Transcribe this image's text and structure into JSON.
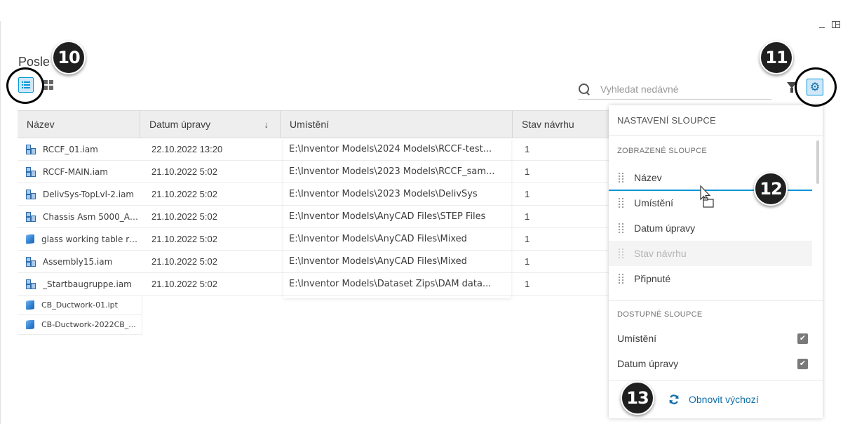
{
  "page": {
    "title": "Posle"
  },
  "search": {
    "placeholder": "Vyhledat nedávné"
  },
  "table": {
    "columns": [
      "Název",
      "Datum úpravy",
      "Umístění",
      "Stav návrhu"
    ],
    "rows": [
      {
        "icon": "assembly-icon",
        "name": "RCCF_01.iam",
        "date": "22.10.2022 13:20",
        "location": "E:\\Inventor Models\\2024 Models\\RCCF-test...",
        "state": "1"
      },
      {
        "icon": "assembly-icon",
        "name": "RCCF-MAIN.iam",
        "date": "21.10.2022 5:02",
        "location": "E:\\Inventor Models\\2023 Models\\RCCF_sam...",
        "state": "1"
      },
      {
        "icon": "assembly-icon",
        "name": "DelivSys-TopLvl-2.iam",
        "date": "21.10.2022 5:02",
        "location": "E:\\Inventor Models\\2023 Models\\DelivSys",
        "state": "1"
      },
      {
        "icon": "assembly-icon",
        "name": "Chassis Asm 5000_AP...",
        "date": "21.10.2022 5:02",
        "location": "E:\\Inventor Models\\AnyCAD Files\\STEP Files",
        "state": "1"
      },
      {
        "icon": "part-icon",
        "name": "glass working table rh...",
        "date": "21.10.2022 5:02",
        "location": "E:\\Inventor Models\\AnyCAD Files\\Mixed",
        "state": "1"
      },
      {
        "icon": "assembly-icon",
        "name": "Assembly15.iam",
        "date": "21.10.2022 5:02",
        "location": "E:\\Inventor Models\\AnyCAD Files\\Mixed",
        "state": "1"
      },
      {
        "icon": "assembly-icon",
        "name": "_Startbaugruppe.iam",
        "date": "21.10.2022 5:02",
        "location": "E:\\Inventor Models\\Dataset Zips\\DAM data...",
        "state": "1"
      }
    ],
    "trailing_rows": [
      {
        "icon": "part-icon",
        "name": "CB_Ductwork-01.ipt"
      },
      {
        "icon": "part-icon",
        "name": "CB-Ductwork-2022CB_..."
      }
    ]
  },
  "panel": {
    "title": "NASTAVENÍ SLOUPCE",
    "shown_heading": "ZOBRAZENÉ SLOUPCE",
    "shown_columns": [
      {
        "label": "Název",
        "disabled": false
      },
      {
        "label": "Umístění",
        "disabled": false
      },
      {
        "label": "Datum úpravy",
        "disabled": false
      },
      {
        "label": "Stav návrhu",
        "disabled": true
      },
      {
        "label": "Připnuté",
        "disabled": false
      }
    ],
    "available_heading": "DOSTUPNÉ SLOUPCE",
    "available_columns": [
      {
        "label": "Umístění",
        "checked": true
      },
      {
        "label": "Datum úpravy",
        "checked": true
      }
    ],
    "reset_label": "Obnovit výchozí"
  },
  "callouts": [
    "10",
    "11",
    "12",
    "13"
  ],
  "colors": {
    "accent": "#0696d7",
    "selected_bg": "#cfe7f8",
    "badge": "#1f1f1f"
  }
}
